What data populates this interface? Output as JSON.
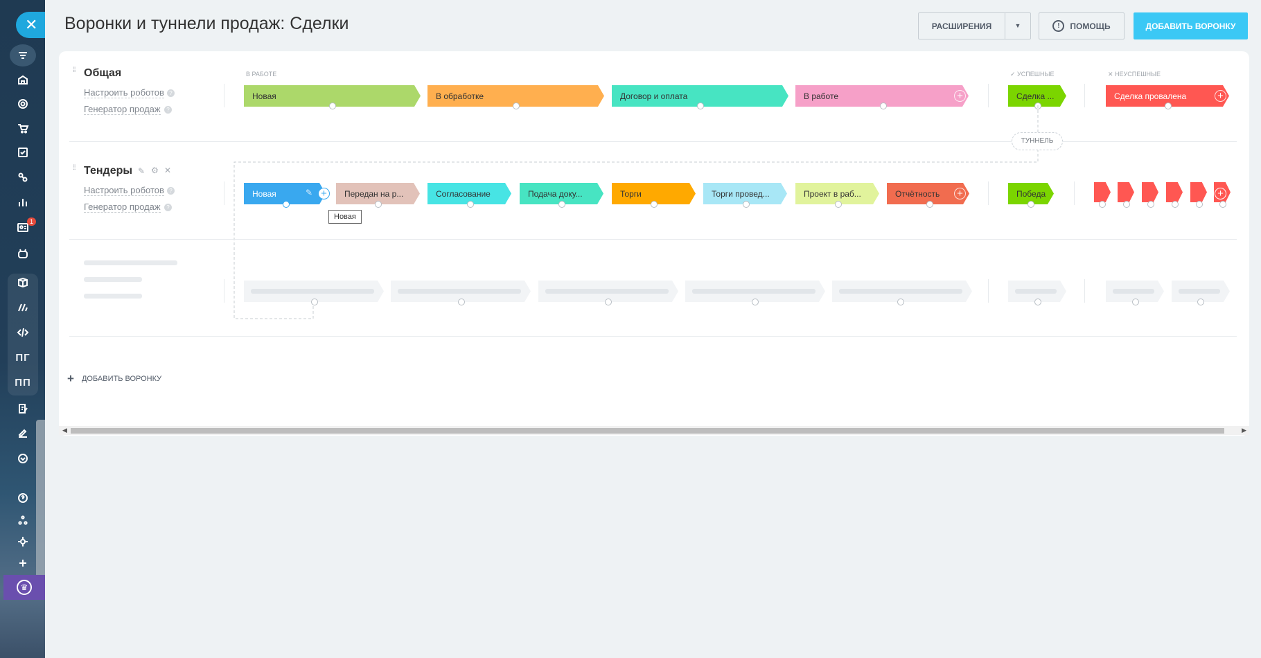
{
  "page": {
    "title": "Воронки и туннели продаж: Сделки"
  },
  "header": {
    "extensions_label": "РАСШИРЕНИЯ",
    "help_label": "ПОМОЩЬ",
    "add_funnel_label": "ДОБАВИТЬ ВОРОНКУ"
  },
  "sidebar": {
    "badge_count": "1",
    "text_items": [
      "ПГ",
      "ПП"
    ]
  },
  "columns": {
    "in_work": "В РАБОТЕ",
    "success": "УСПЕШНЫЕ",
    "fail": "НЕУСПЕШНЫЕ"
  },
  "funnels": [
    {
      "name": "Общая",
      "robots_link": "Настроить роботов",
      "generator_link": "Генератор продаж",
      "stages": [
        "Новая",
        "В обработке",
        "Договор и оплата",
        "В работе"
      ],
      "success": "Сделка ...",
      "fail": "Сделка провалена",
      "colors": {
        "stage1": "#acd86a",
        "stage2": "#ffaf4f",
        "stage3": "#47e4c2",
        "stage4": "#f6a0c8",
        "success": "#7bd500",
        "fail": "#ff5752"
      }
    },
    {
      "name": "Тендеры",
      "robots_link": "Настроить роботов",
      "generator_link": "Генератор продаж",
      "stages": [
        "Новая",
        "Передан на р...",
        "Согласование",
        "Подача доку...",
        "Торги",
        "Торги провед...",
        "Проект в раб...",
        "Отчётность"
      ],
      "success": "Победа",
      "colors": {
        "stage1": "#39a8ef",
        "stage2": "#e2c2b9",
        "stage3": "#47e4e4",
        "stage4": "#47e4c2",
        "stage5": "#ffa900",
        "stage6": "#a8e7f6",
        "stage7": "#e1f39c",
        "stage8": "#f16c4f",
        "success": "#7bd500",
        "fail": "#ff5752"
      }
    }
  ],
  "tunnel_label": "ТУННЕЛЬ",
  "tooltip": "Новая",
  "add_funnel_link": "ДОБАВИТЬ ВОРОНКУ"
}
